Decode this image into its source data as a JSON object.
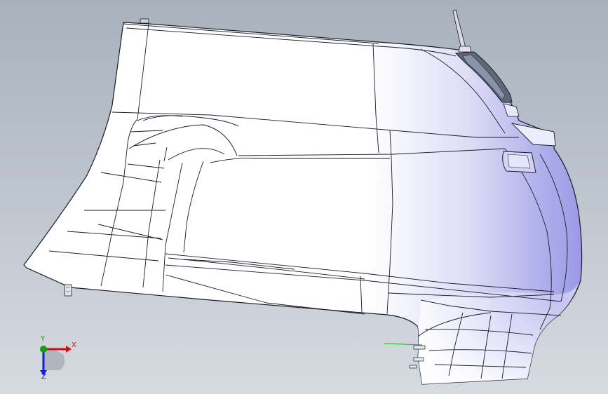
{
  "viewport": {
    "background_top": "#a9b1bc",
    "background_bottom": "#d6dbe1"
  },
  "model": {
    "part": "rear-quarter-panel",
    "shading": "white-to-lavender",
    "edge_color": "#1a1a2a",
    "tint_color": "#9a9ae6"
  },
  "triad": {
    "x_label": "X",
    "y_label": "Y",
    "z_label": "Z",
    "x_color": "#d01010",
    "y_color": "#10a010",
    "z_color": "#1020d0"
  }
}
